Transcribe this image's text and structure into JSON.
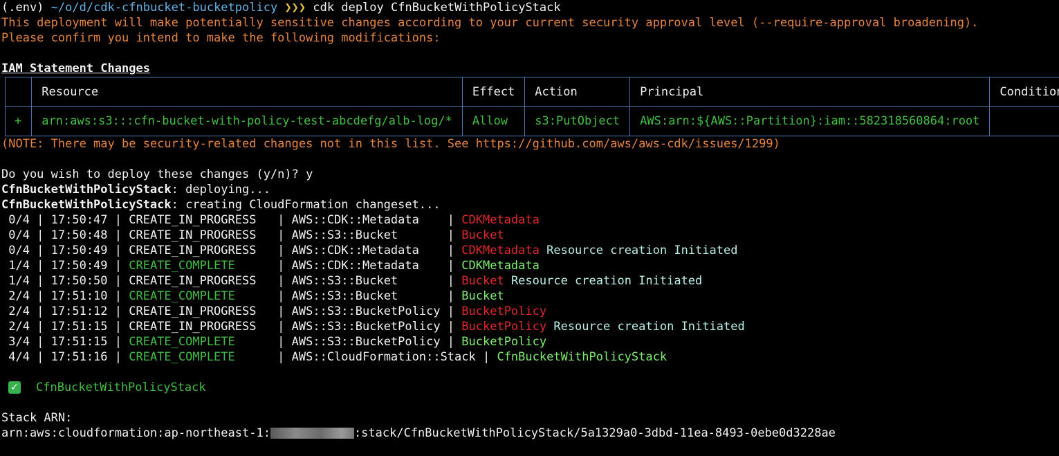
{
  "prompt": {
    "env": "(.env)",
    "cwd": "~/o/d/cdk-cfnbucket-bucketpolicy",
    "arrows": "❯❯❯",
    "command": "cdk deploy CfnBucketWithPolicyStack"
  },
  "warning": {
    "line1": "This deployment will make potentially sensitive changes according to your current security approval level (--require-approval broadening).",
    "line2": "Please confirm you intend to make the following modifications:"
  },
  "iam": {
    "heading": "IAM Statement Changes",
    "headers": [
      "Resource",
      "Effect",
      "Action",
      "Principal",
      "Condition"
    ],
    "row": {
      "mark": "+",
      "resource": "arn:aws:s3:::cfn-bucket-with-policy-test-abcdefg/alb-log/*",
      "effect": "Allow",
      "action": "s3:PutObject",
      "principal": "AWS:arn:${AWS::Partition}:iam::582318560864:root",
      "condition": ""
    }
  },
  "note": "(NOTE: There may be security-related changes not in this list. See https://github.com/aws/aws-cdk/issues/1299)",
  "confirm": "Do you wish to deploy these changes (y/n)? y",
  "deploying": {
    "stack": "CfnBucketWithPolicyStack",
    "line1_rest": ": deploying...",
    "line2_rest": ": creating CloudFormation changeset..."
  },
  "events": [
    {
      "left": " 0/4 | 17:50:47 | ",
      "status": "CREATE_IN_PROGRESS  ",
      "status_color": "white",
      "type": " | AWS::CDK::Metadata    | ",
      "resource": "CDKMetadata",
      "res_color": "red",
      "extra": ""
    },
    {
      "left": " 0/4 | 17:50:48 | ",
      "status": "CREATE_IN_PROGRESS  ",
      "status_color": "white",
      "type": " | AWS::S3::Bucket       | ",
      "resource": "Bucket",
      "res_color": "red",
      "extra": ""
    },
    {
      "left": " 0/4 | 17:50:49 | ",
      "status": "CREATE_IN_PROGRESS  ",
      "status_color": "white",
      "type": " | AWS::CDK::Metadata    | ",
      "resource": "CDKMetadata",
      "res_color": "red",
      "extra": " Resource creation Initiated"
    },
    {
      "left": " 1/4 | 17:50:49 | ",
      "status": "CREATE_COMPLETE     ",
      "status_color": "green",
      "type": " | AWS::CDK::Metadata    | ",
      "resource": "CDKMetadata",
      "res_color": "bgreen",
      "extra": ""
    },
    {
      "left": " 1/4 | 17:50:50 | ",
      "status": "CREATE_IN_PROGRESS  ",
      "status_color": "white",
      "type": " | AWS::S3::Bucket       | ",
      "resource": "Bucket",
      "res_color": "red",
      "extra": " Resource creation Initiated"
    },
    {
      "left": " 2/4 | 17:51:10 | ",
      "status": "CREATE_COMPLETE     ",
      "status_color": "green",
      "type": " | AWS::S3::Bucket       | ",
      "resource": "Bucket",
      "res_color": "bgreen",
      "extra": ""
    },
    {
      "left": " 2/4 | 17:51:12 | ",
      "status": "CREATE_IN_PROGRESS  ",
      "status_color": "white",
      "type": " | AWS::S3::BucketPolicy | ",
      "resource": "BucketPolicy",
      "res_color": "red",
      "extra": ""
    },
    {
      "left": " 2/4 | 17:51:15 | ",
      "status": "CREATE_IN_PROGRESS  ",
      "status_color": "white",
      "type": " | AWS::S3::BucketPolicy | ",
      "resource": "BucketPolicy",
      "res_color": "red",
      "extra": " Resource creation Initiated"
    },
    {
      "left": " 3/4 | 17:51:15 | ",
      "status": "CREATE_COMPLETE     ",
      "status_color": "green",
      "type": " | AWS::S3::BucketPolicy | ",
      "resource": "BucketPolicy",
      "res_color": "bgreen",
      "extra": ""
    },
    {
      "left": " 4/4 | 17:51:16 | ",
      "status": "CREATE_COMPLETE     ",
      "status_color": "green",
      "type": " | AWS::CloudFormation::Stack | ",
      "resource": "CfnBucketWithPolicyStack",
      "res_color": "bgreen",
      "extra": ""
    }
  ],
  "done": {
    "icon": "check-mark-icon",
    "stack": "CfnBucketWithPolicyStack"
  },
  "arn": {
    "label": "Stack ARN:",
    "prefix": "arn:aws:cloudformation:ap-northeast-1:",
    "suffix": ":stack/CfnBucketWithPolicyStack/5a1329a0-3dbd-11ea-8493-0ebe0d3228ae"
  },
  "colors": {
    "background": "#000000",
    "warning": "#e5843a",
    "path": "#5fb3e6",
    "success": "#3fbf3f",
    "resource_complete": "#7bee6b",
    "resource_pending": "#e0272a",
    "initiated": "#b8f0e8",
    "table_border": "#4c73b0"
  }
}
